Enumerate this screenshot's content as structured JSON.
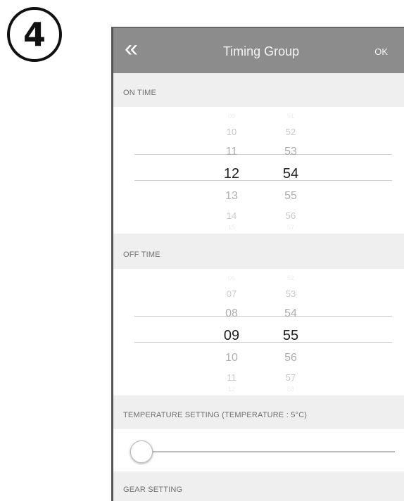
{
  "step_number": "4",
  "navbar": {
    "back_icon": "double-chevron-left-icon",
    "back_glyph": "«",
    "title": "Timing Group",
    "ok_label": "OK"
  },
  "on_time": {
    "label": "ON TIME",
    "hours": [
      "09",
      "10",
      "11",
      "12",
      "13",
      "14",
      "15"
    ],
    "minutes": [
      "51",
      "52",
      "53",
      "54",
      "55",
      "56",
      "57"
    ],
    "selected_hour": "12",
    "selected_minute": "54"
  },
  "off_time": {
    "label": "OFF TIME",
    "hours": [
      "06",
      "07",
      "08",
      "09",
      "10",
      "11",
      "12"
    ],
    "minutes": [
      "52",
      "53",
      "54",
      "55",
      "56",
      "57",
      "58"
    ],
    "selected_hour": "09",
    "selected_minute": "55"
  },
  "temperature": {
    "label": "TEMPERATURE SETTING (TEMPERATURE : 5°C)",
    "value_fraction": 0.0
  },
  "gear": {
    "label": "GEAR SETTING"
  },
  "colors": {
    "navbar": "#8c8c8c",
    "section_bg": "#efefef",
    "selected_text": "#222222",
    "dim_text": "#a5a5a5"
  }
}
